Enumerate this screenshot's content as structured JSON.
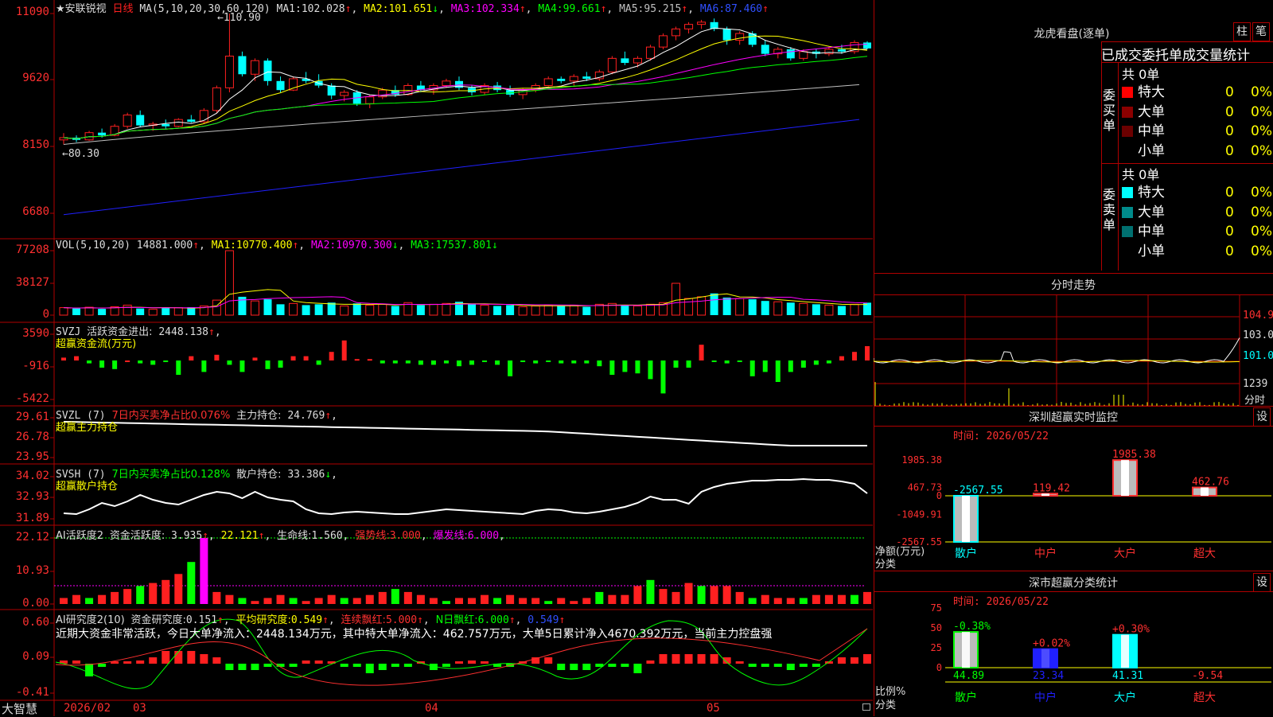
{
  "app": {
    "stock_title": "★安联锐视",
    "period": "日线",
    "logo": "大智慧"
  },
  "colors": {
    "up": "#ff2020",
    "down": "#00ffff",
    "grid": "#b00000",
    "ma1": "#ffffff",
    "ma2": "#ffff00",
    "ma3": "#ff00ff",
    "ma4": "#00ff00",
    "ma5": "#c0c0c0",
    "ma6": "#2020ff"
  },
  "price_panel": {
    "ma_label": "MA(5,10,20,30,60,120)",
    "ma": [
      {
        "name": "MA1:",
        "value": "102.028",
        "arrow": "↑"
      },
      {
        "name": "MA2:",
        "value": "101.651",
        "arrow": "↓"
      },
      {
        "name": "MA3:",
        "value": "102.334",
        "arrow": "↑"
      },
      {
        "name": "MA4:",
        "value": "99.661",
        "arrow": "↑"
      },
      {
        "name": "MA5:",
        "value": "95.215",
        "arrow": "↑"
      },
      {
        "name": "MA6:",
        "value": "87.460",
        "arrow": "↑"
      }
    ],
    "y_ticks": [
      "11090",
      "9620",
      "8150",
      "6680"
    ],
    "high_label": "110.90",
    "low_label": "80.30"
  },
  "vol_panel": {
    "label": "VOL(5,10,20)",
    "value": "14881.000",
    "ma": [
      {
        "name": "MA1:",
        "value": "10770.400",
        "arrow": "↑"
      },
      {
        "name": "MA2:",
        "value": "10970.300",
        "arrow": "↓"
      },
      {
        "name": "MA3:",
        "value": "17537.801",
        "arrow": "↓"
      }
    ],
    "y_ticks": [
      "77208",
      "38127",
      "0"
    ]
  },
  "svzj_panel": {
    "label": "SVZJ",
    "item": "活跃资金进出:",
    "value": "2448.138",
    "subtitle": "超赢资金流(万元)",
    "y_ticks": [
      "3590",
      "-916",
      "-5422"
    ]
  },
  "svzl_panel": {
    "label": "SVZL (7)",
    "item1": "7日内买卖净占比0.076%",
    "item2": "主力持仓:",
    "value": "24.769",
    "subtitle": "超赢主力持仓",
    "y_ticks": [
      "29.61",
      "26.78",
      "23.95"
    ]
  },
  "svsh_panel": {
    "label": "SVSH (7)",
    "item1": "7日内买卖净占比0.128%",
    "item2": "散户持仓:",
    "value": "33.386",
    "subtitle": "超赢散户持仓",
    "y_ticks": [
      "34.02",
      "32.93",
      "31.89"
    ]
  },
  "ai1_panel": {
    "label": "AI活跃度2",
    "item1": "资金活跃度:",
    "v1": "3.935",
    "v2": "22.121",
    "item3": "生命线:",
    "v3": "1.560",
    "item4": "强势线:",
    "v4": "3.000",
    "item5": "爆发线:",
    "v5": "6.000",
    "y_ticks": [
      "22.12",
      "10.93",
      "0.00"
    ]
  },
  "ai2_panel": {
    "label": "AI研究度2(10)",
    "item1": "资金研究度:",
    "v1": "0.151",
    "item2": "平均研究度:",
    "v2": "0.549",
    "item3": "连续飘红:",
    "v3": "5.000",
    "item4": "N日飘红:",
    "v4": "6.000",
    "v5": "0.549",
    "comment": "近期大资金非常活跃，今日大单净流入：2448.134万元，其中特大单净流入：462.757万元，大单5日累计净入4670.392万元，当前主力控盘强",
    "y_ticks": [
      "0.60",
      "0.09",
      "-0.41"
    ]
  },
  "x_axis": {
    "labels": [
      "2026/02",
      "03",
      "04",
      "05"
    ]
  },
  "right": {
    "longhu_title": "龙虎看盘(逐单)",
    "btn_zhu": "柱",
    "btn_bi": "笔",
    "stats_title": "已成交委托单成交量统计",
    "buy_side": {
      "label": "委买单",
      "total": "共 0单",
      "rows": [
        {
          "name": "特大",
          "v": "0",
          "p": "0%",
          "color": "#ff0000"
        },
        {
          "name": "大单",
          "v": "0",
          "p": "0%",
          "color": "#8b0000"
        },
        {
          "name": "中单",
          "v": "0",
          "p": "0%",
          "color": "#6b0000"
        },
        {
          "name": "小单",
          "v": "0",
          "p": "0%",
          "color": "#000000"
        }
      ]
    },
    "sell_side": {
      "label": "委卖单",
      "total": "共 0单",
      "rows": [
        {
          "name": "特大",
          "v": "0",
          "p": "0%",
          "color": "#00ffff"
        },
        {
          "name": "大单",
          "v": "0",
          "p": "0%",
          "color": "#008b8b"
        },
        {
          "name": "中单",
          "v": "0",
          "p": "0%",
          "color": "#007070"
        },
        {
          "name": "小单",
          "v": "0",
          "p": "0%",
          "color": "#000000"
        }
      ]
    },
    "fenshi": {
      "title": "分时走势",
      "y_labels": [
        "104.9",
        "103.0",
        "101.0",
        "1239",
        "分时"
      ]
    },
    "monitor": {
      "title": "深圳超赢实时监控",
      "btn": "设",
      "time": "时间: 2026/05/22",
      "y_ticks": [
        "1985.38",
        "467.73",
        "0",
        "-1049.91",
        "-2567.55"
      ],
      "y_label": "净额(万元)",
      "x_label": "分类",
      "cats": [
        "散户",
        "中户",
        "大户",
        "超大"
      ],
      "values": [
        -2567.55,
        119.42,
        1985.38,
        462.76
      ],
      "value_labels": [
        "-2567.55",
        "119.42",
        "1985.38",
        "462.76"
      ]
    },
    "classify": {
      "title": "深市超赢分类统计",
      "btn": "设",
      "time": "时间: 2026/05/22",
      "y_ticks": [
        "75",
        "50",
        "25",
        "0"
      ],
      "y_label": "比例%",
      "x_label": "分类",
      "cats": [
        "散户",
        "中户",
        "大户",
        "超大"
      ],
      "pct": [
        44.89,
        23.34,
        41.31,
        -9.54
      ],
      "pct_labels": [
        "44.89",
        "23.34",
        "41.31",
        "-9.54"
      ],
      "chg_labels": [
        "-0.38%",
        "+0.02%",
        "+0.30%",
        ""
      ]
    }
  },
  "chart_data": [
    {
      "type": "candlestick",
      "title": "★安联锐视 日线",
      "ylim": [
        6680,
        11090
      ],
      "y_ticks": [
        11090,
        9620,
        8150,
        6680
      ],
      "high": 110.9,
      "low": 80.3,
      "ohlc": [
        [
          83.0,
          84.5,
          82.0,
          83.5
        ],
        [
          83.5,
          84.0,
          82.5,
          83.0
        ],
        [
          83.0,
          85.0,
          82.8,
          84.6
        ],
        [
          84.6,
          85.5,
          83.5,
          84.0
        ],
        [
          84.0,
          86.5,
          83.8,
          86.0
        ],
        [
          86.0,
          89.0,
          85.5,
          88.5
        ],
        [
          88.5,
          89.5,
          85.8,
          86.2
        ],
        [
          86.2,
          87.0,
          85.0,
          86.5
        ],
        [
          86.5,
          87.5,
          85.5,
          86.0
        ],
        [
          86.0,
          87.8,
          85.8,
          87.5
        ],
        [
          87.5,
          88.5,
          86.8,
          87.0
        ],
        [
          87.0,
          90.0,
          86.5,
          89.5
        ],
        [
          89.5,
          95.0,
          89.0,
          94.5
        ],
        [
          94.5,
          110.9,
          93.5,
          101.5
        ],
        [
          101.5,
          102.5,
          97.0,
          97.5
        ],
        [
          97.5,
          101.0,
          96.0,
          100.5
        ],
        [
          100.5,
          101.0,
          95.0,
          96.0
        ],
        [
          96.0,
          97.0,
          93.5,
          94.0
        ],
        [
          94.0,
          97.0,
          93.8,
          96.5
        ],
        [
          96.5,
          98.0,
          95.5,
          96.0
        ],
        [
          96.0,
          97.5,
          94.5,
          95.0
        ],
        [
          95.0,
          95.5,
          92.0,
          92.8
        ],
        [
          92.8,
          94.0,
          91.5,
          93.5
        ],
        [
          93.5,
          94.0,
          90.5,
          91.0
        ],
        [
          91.0,
          93.0,
          90.0,
          92.5
        ],
        [
          92.5,
          94.5,
          92.0,
          94.0
        ],
        [
          94.0,
          95.0,
          92.5,
          93.0
        ],
        [
          93.0,
          95.5,
          92.8,
          95.0
        ],
        [
          95.0,
          96.0,
          93.5,
          94.0
        ],
        [
          94.0,
          95.5,
          93.0,
          95.0
        ],
        [
          95.0,
          96.5,
          94.5,
          96.0
        ],
        [
          96.0,
          97.0,
          94.0,
          94.5
        ],
        [
          94.5,
          95.0,
          92.8,
          93.5
        ],
        [
          93.5,
          95.5,
          93.0,
          95.0
        ],
        [
          95.0,
          95.8,
          93.5,
          94.0
        ],
        [
          94.0,
          95.0,
          92.5,
          93.0
        ],
        [
          93.0,
          94.5,
          92.0,
          94.0
        ],
        [
          94.0,
          95.5,
          93.5,
          95.0
        ],
        [
          95.0,
          97.0,
          94.8,
          96.5
        ],
        [
          96.5,
          97.0,
          95.5,
          96.0
        ],
        [
          96.0,
          97.5,
          95.0,
          97.0
        ],
        [
          97.0,
          98.0,
          96.0,
          96.5
        ],
        [
          96.5,
          98.5,
          96.0,
          98.0
        ],
        [
          98.0,
          101.5,
          97.5,
          101.0
        ],
        [
          101.0,
          102.5,
          99.5,
          100.0
        ],
        [
          100.0,
          101.5,
          99.0,
          101.0
        ],
        [
          101.0,
          104.0,
          100.5,
          103.5
        ],
        [
          103.5,
          106.5,
          103.0,
          106.0
        ],
        [
          106.0,
          108.0,
          105.0,
          107.5
        ],
        [
          107.5,
          109.0,
          106.5,
          108.5
        ],
        [
          108.5,
          109.5,
          107.5,
          109.0
        ],
        [
          109.0,
          109.8,
          107.0,
          107.5
        ],
        [
          107.5,
          108.0,
          104.0,
          105.0
        ],
        [
          105.0,
          107.0,
          104.0,
          106.5
        ],
        [
          106.5,
          107.0,
          103.5,
          104.0
        ],
        [
          104.0,
          105.0,
          101.5,
          102.0
        ],
        [
          102.0,
          103.5,
          101.0,
          103.0
        ],
        [
          103.0,
          103.5,
          100.5,
          101.0
        ],
        [
          101.0,
          103.0,
          100.5,
          102.5
        ],
        [
          102.5,
          103.0,
          101.0,
          102.0
        ],
        [
          102.0,
          103.5,
          101.5,
          103.0
        ],
        [
          103.0,
          104.0,
          102.0,
          102.5
        ],
        [
          102.5,
          105.0,
          102.0,
          104.5
        ],
        [
          104.5,
          104.8,
          103.0,
          103.2
        ]
      ]
    },
    {
      "type": "bar",
      "title": "VOL(5,10,20)",
      "ylim": [
        0,
        77208
      ],
      "values": [
        9000,
        8000,
        9500,
        7500,
        10000,
        12000,
        8000,
        7000,
        8500,
        9000,
        9500,
        11000,
        18000,
        77208,
        22000,
        17000,
        19000,
        13000,
        14000,
        12000,
        13000,
        15000,
        11000,
        14000,
        12000,
        13000,
        11000,
        15000,
        12000,
        13000,
        14000,
        16000,
        13000,
        12000,
        11000,
        12000,
        10000,
        11000,
        12000,
        11000,
        12000,
        10000,
        13000,
        14000,
        12000,
        11000,
        13000,
        15000,
        38127,
        20000,
        22000,
        26000,
        21000,
        20000,
        19000,
        17000,
        16000,
        15000,
        14000,
        13000,
        12000,
        11000,
        13000,
        14881
      ]
    }
  ]
}
